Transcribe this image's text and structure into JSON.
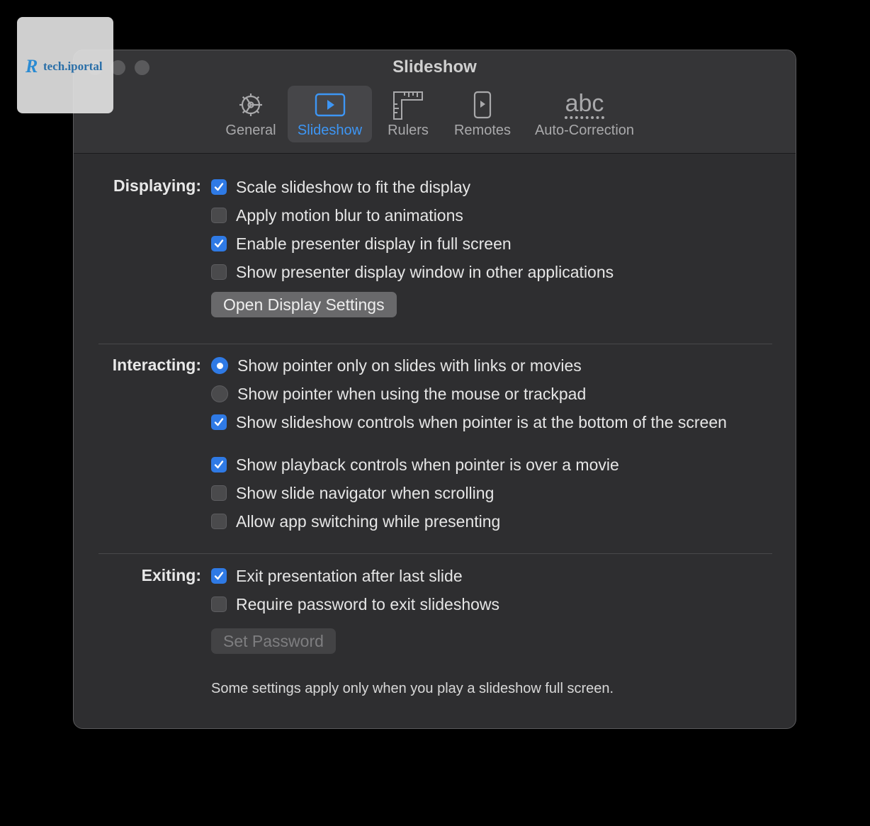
{
  "window": {
    "title": "Slideshow",
    "tabs": [
      {
        "label": "General",
        "icon": "gear-icon"
      },
      {
        "label": "Slideshow",
        "icon": "play-icon",
        "selected": true
      },
      {
        "label": "Rulers",
        "icon": "ruler-icon"
      },
      {
        "label": "Remotes",
        "icon": "iphone-remote-icon"
      },
      {
        "label": "Auto-Correction",
        "icon": "abc-icon"
      }
    ],
    "abc_icon_text": "abc"
  },
  "displaying": {
    "label": "Displaying:",
    "options": [
      {
        "label": "Scale slideshow to fit the display",
        "checked": true
      },
      {
        "label": "Apply motion blur to animations",
        "checked": false
      },
      {
        "label": "Enable presenter display in full screen",
        "checked": true
      },
      {
        "label": "Show presenter display window in other applications",
        "checked": false
      }
    ],
    "button": "Open Display Settings"
  },
  "interacting": {
    "label": "Interacting:",
    "radios": [
      {
        "label": "Show pointer only on slides with links or movies",
        "selected": true
      },
      {
        "label": "Show pointer when using the mouse or trackpad",
        "selected": false
      }
    ],
    "options": [
      {
        "label": "Show slideshow controls when pointer is at the bottom of the screen",
        "checked": true
      },
      {
        "label": "Show playback controls when pointer is over a movie",
        "checked": true
      },
      {
        "label": "Show slide navigator when scrolling",
        "checked": false
      },
      {
        "label": "Allow app switching while presenting",
        "checked": false
      }
    ]
  },
  "exiting": {
    "label": "Exiting:",
    "options": [
      {
        "label": "Exit presentation after last slide",
        "checked": true
      },
      {
        "label": "Require password to exit slideshows",
        "checked": false
      }
    ],
    "button": "Set Password",
    "button_enabled": false
  },
  "footnote": "Some settings apply only when you play a slideshow full screen.",
  "watermark": {
    "text": "tech.iportal",
    "mark": "R"
  },
  "colors": {
    "accent": "#2f7ae5",
    "selected_tab_text": "#3d96f5",
    "window_bg": "#2e2e30"
  }
}
